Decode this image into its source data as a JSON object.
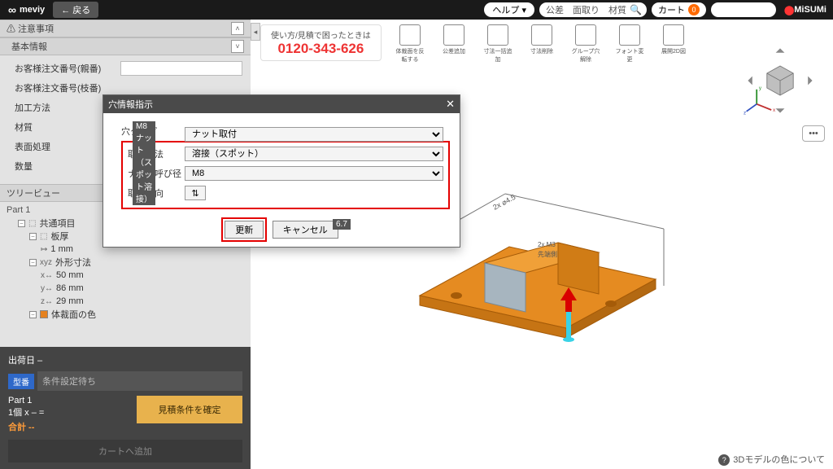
{
  "header": {
    "logo": "meviy",
    "back": "戻る",
    "help": "ヘルプ ▾",
    "search_placeholder": "公差　面取り　材質",
    "cart_label": "カート",
    "cart_count": "0",
    "misumi": "MiSUMi"
  },
  "sidebar": {
    "panels": {
      "caution": "注意事項",
      "basic": "基本情報",
      "tree": "ツリービュー"
    },
    "basic_fields": {
      "order_no1": "お客様注文番号(親番)",
      "order_no2": "お客様注文番号(枝番)",
      "method": "加工方法",
      "material": "材質",
      "surface": "表面処理",
      "qty": "数量"
    },
    "tree": {
      "root": "Part 1",
      "common": "共通項目",
      "thickness": "板厚",
      "thickness_v": "1 mm",
      "dims": "外形寸法",
      "x": "50 mm",
      "y": "86 mm",
      "z": "29 mm",
      "color": "体裁面の色"
    }
  },
  "quote": {
    "ship": "出荷日 –",
    "model_badge": "型番",
    "cond": "条件設定待ち",
    "part": "Part 1",
    "qty_line": "1個  x – =",
    "total": "合計 --",
    "confirm": "見積条件を確定",
    "add_cart": "カートへ追加"
  },
  "ribbon": {
    "help_line": "使い方/見積で困ったときは",
    "tel": "0120-343-626",
    "tools": [
      "体裁面を反転する",
      "公差追加",
      "寸法一括追加",
      "寸法削除",
      "グループ穴解除",
      "フォント変更",
      "展開2D図"
    ]
  },
  "dialog": {
    "title": "穴情報指示",
    "drawing_label": "M8 ナット（スポット溶接）",
    "dim67": "6.7",
    "fields": {
      "hole_type": {
        "label": "穴タイプ",
        "value": "ナット取付"
      },
      "method": {
        "label": "取付方法",
        "value": "溶接（スポット）"
      },
      "size": {
        "label": "ナット呼び径",
        "value": "M8"
      },
      "direction": {
        "label": "取付方向"
      }
    },
    "buttons": {
      "ok": "更新",
      "cancel": "キャンセル"
    }
  },
  "footer": {
    "link": "3Dモデルの色について"
  }
}
